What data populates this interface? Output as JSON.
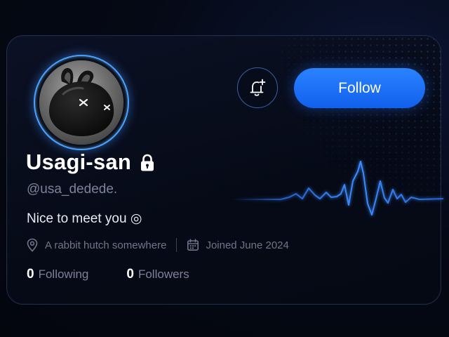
{
  "profile": {
    "name": "Usagi-san",
    "handle": "@usa_dedede.",
    "bio": "Nice to meet you ◎",
    "location": "A rabbit hutch somewhere",
    "joined": "Joined June 2024",
    "private": true
  },
  "actions": {
    "follow_label": "Follow",
    "notify_icon": "bell-plus-icon"
  },
  "stats": {
    "following_count": "0",
    "following_label": "Following",
    "followers_count": "0",
    "followers_label": "Followers"
  },
  "icons": {
    "lock": "lock-icon",
    "location": "map-pin-icon",
    "calendar": "calendar-icon"
  },
  "colors": {
    "accent": "#1f6fff",
    "ring": "#4aa0ff",
    "background": "#03060f",
    "muted_text": "#7c8398"
  }
}
